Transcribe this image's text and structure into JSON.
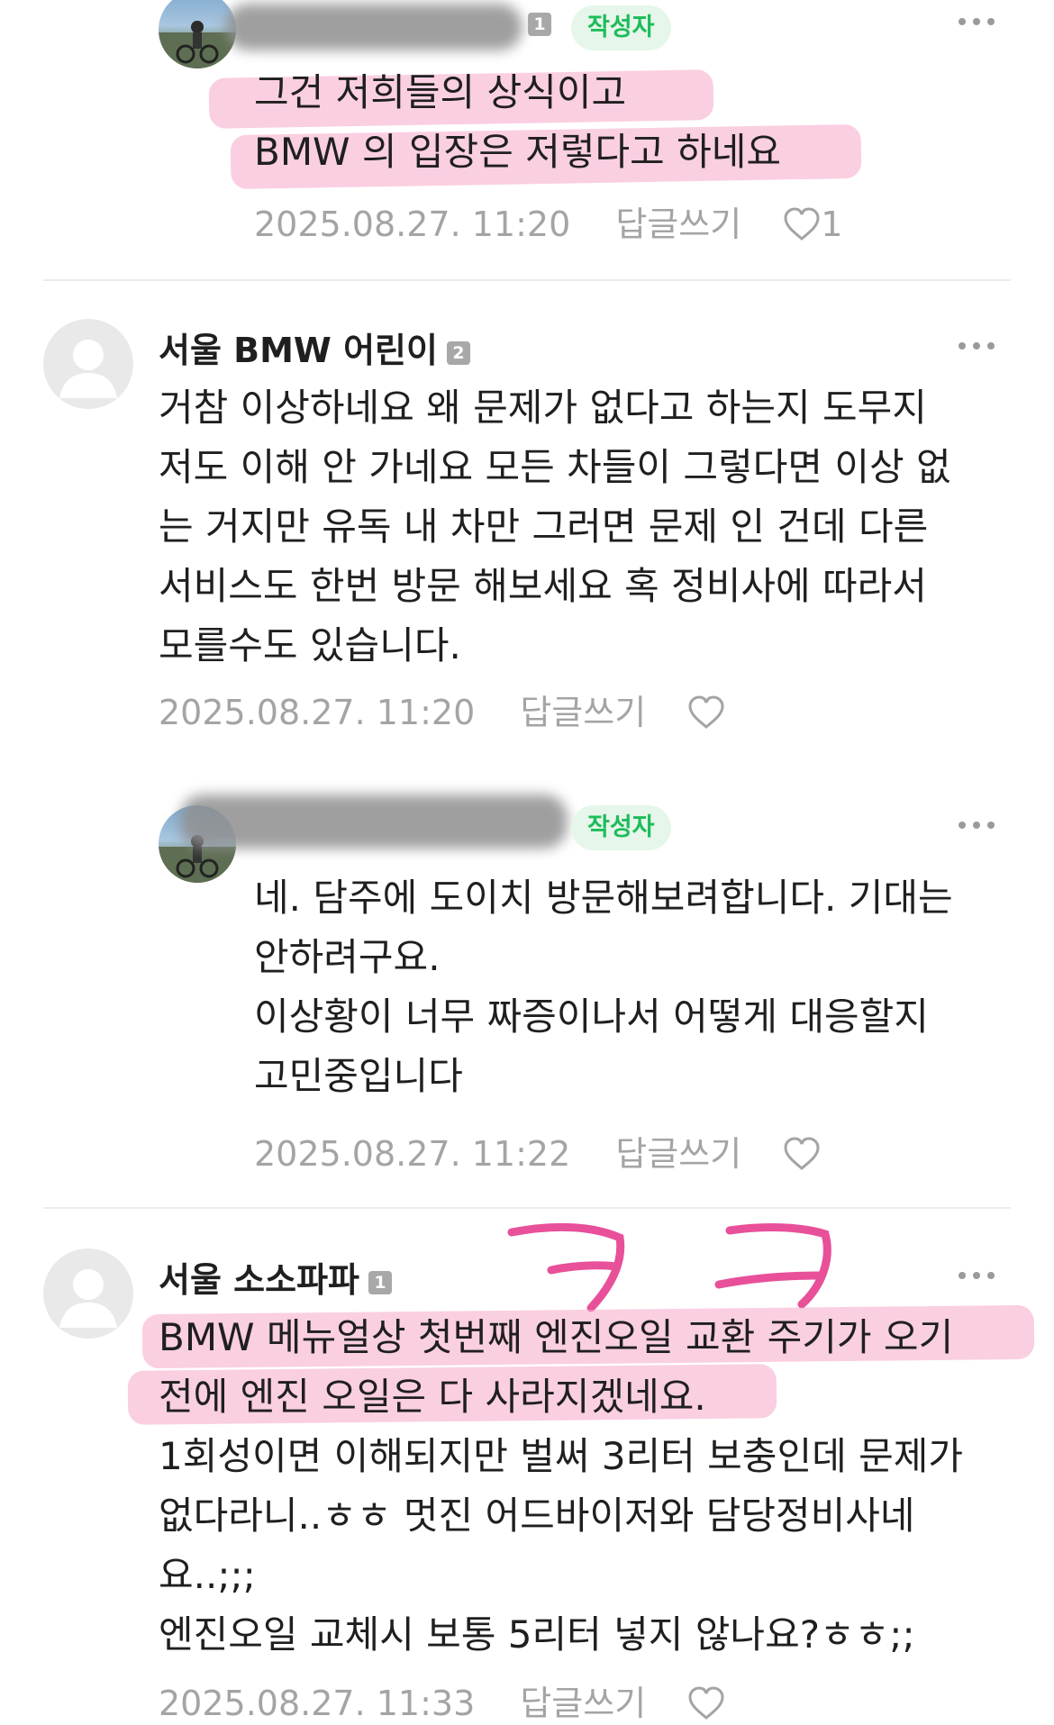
{
  "comments": [
    {
      "author_badge": "작성자",
      "text": "그건 저희들의 상식이고\nBMW 의 입장은 저렇다고 하네요",
      "timestamp": "2025.08.27. 11:20",
      "reply_label": "답글쓰기",
      "like_count": "1"
    },
    {
      "author": "서울 BMW 어린이",
      "level": "2",
      "text": "거참 이상하네요 왜 문제가 없다고 하는지 도무지\n저도 이해 안 가네요 모든 차들이 그렇다면 이상 없\n는 거지만 유독 내 차만 그러면 문제 인 건데 다른\n서비스도 한번 방문 해보세요 혹 정비사에 따라서\n모를수도 있습니다.",
      "timestamp": "2025.08.27. 11:20",
      "reply_label": "답글쓰기"
    },
    {
      "author_badge": "작성자",
      "text": "네. 담주에 도이치 방문해보려합니다. 기대는\n안하려구요.\n이상황이 너무 짜증이나서 어떻게 대응할지\n고민중입니다",
      "timestamp": "2025.08.27. 11:22",
      "reply_label": "답글쓰기"
    },
    {
      "author": "서울 소소파파",
      "level": "1",
      "text": "BMW 메뉴얼상 첫번째 엔진오일 교환 주기가 오기\n전에 엔진 오일은 다 사라지겠네요.\n1회성이면 이해되지만 벌써 3리터 보충인데 문제가\n없다라니..ㅎㅎ 멋진 어드바이저와 담당정비사네\n요..;;;\n엔진오일 교체시 보통 5리터 넣지 않나요?ㅎㅎ;;",
      "timestamp": "2025.08.27. 11:33",
      "reply_label": "답글쓰기"
    }
  ],
  "icons": {
    "more": "more-horizontal-icon",
    "like": "heart-icon",
    "default_avatar": "person-silhouette-icon"
  },
  "colors": {
    "badge_text": "#1ebc5a",
    "badge_bg": "#e6f6ea",
    "meta_text": "#a4a4a4",
    "highlight": "#f6a8c8",
    "annotation": "#e8509a"
  }
}
